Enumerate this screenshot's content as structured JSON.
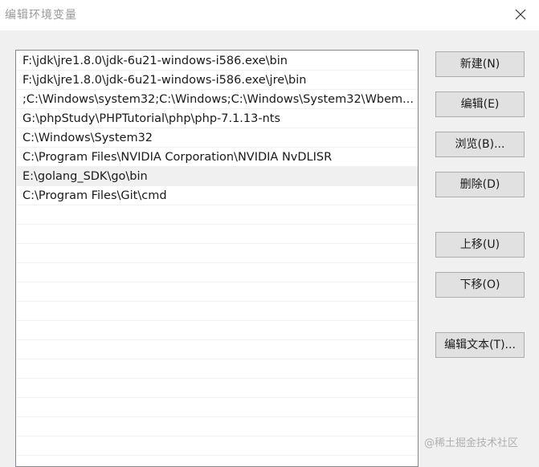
{
  "window": {
    "title": "编辑环境变量",
    "close_icon": "close-icon"
  },
  "paths": [
    "F:\\jdk\\jre1.8.0\\jdk-6u21-windows-i586.exe\\bin",
    "F:\\jdk\\jre1.8.0\\jdk-6u21-windows-i586.exe\\jre\\bin",
    ";C:\\Windows\\system32;C:\\Windows;C:\\Windows\\System32\\Wbem...",
    "G:\\phpStudy\\PHPTutorial\\php\\php-7.1.13-nts",
    "C:\\Windows\\System32",
    "C:\\Program Files\\NVIDIA Corporation\\NVIDIA NvDLISR",
    "E:\\golang_SDK\\go\\bin",
    "C:\\Program Files\\Git\\cmd"
  ],
  "selected_index": 6,
  "buttons": {
    "new": "新建(N)",
    "edit": "编辑(E)",
    "browse": "浏览(B)...",
    "delete": "删除(D)",
    "move_up": "上移(U)",
    "move_down": "下移(O)",
    "edit_text": "编辑文本(T)..."
  },
  "watermark": "@稀土掘金技术社区"
}
